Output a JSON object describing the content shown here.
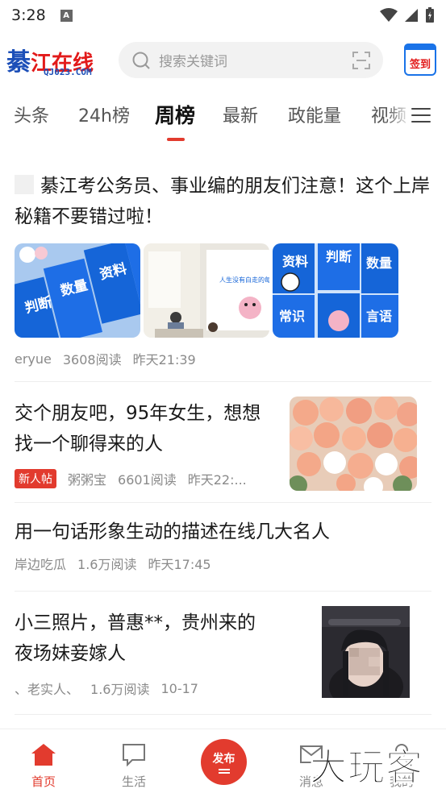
{
  "status_bar": {
    "time": "3:28",
    "notif_letter": "A"
  },
  "header": {
    "logo_big": "綦",
    "logo_rest": "江在线",
    "logo_sub": "QJ023.COM",
    "search_placeholder": "搜索关键词",
    "signin_label": "签到"
  },
  "tabs": [
    {
      "label": "头条"
    },
    {
      "label": "24h榜"
    },
    {
      "label": "周榜"
    },
    {
      "label": "最新"
    },
    {
      "label": "政能量"
    },
    {
      "label": "视频"
    }
  ],
  "active_tab": "周榜",
  "articles": [
    {
      "title": "綦江考公务员、事业编的朋友们注意！这个上岸秘籍不要错过啦！",
      "author": "eryue",
      "reads": "3608阅读",
      "time": "昨天21:39",
      "image_texts": [
        "判断",
        "数量",
        "资料",
        "言语",
        "常识",
        "人生没有白走的每一步都算数"
      ]
    },
    {
      "title": "交个朋友吧，95年女生，想想找一个聊得来的人",
      "badge": "新人帖",
      "author": "粥粥宝",
      "reads": "6601阅读",
      "time": "昨天22:..."
    },
    {
      "title": "用一句话形象生动的描述在线几大名人",
      "author": "岸边吃瓜",
      "reads": "1.6万阅读",
      "time": "昨天17:45"
    },
    {
      "title": "小三照片，普惠**，贵州来的夜场妹妾嫁人",
      "author": "、老实人、",
      "reads": "1.6万阅读",
      "time": "10-17"
    }
  ],
  "bottom_nav": [
    {
      "label": "首页"
    },
    {
      "label": "生活"
    },
    {
      "label": "发布"
    },
    {
      "label": "消息"
    },
    {
      "label": "我的"
    }
  ],
  "watermark": "大玩客",
  "colors": {
    "accent": "#e23b2e",
    "brand_blue": "#1c4fb8",
    "badge_red": "#e23b2e"
  }
}
